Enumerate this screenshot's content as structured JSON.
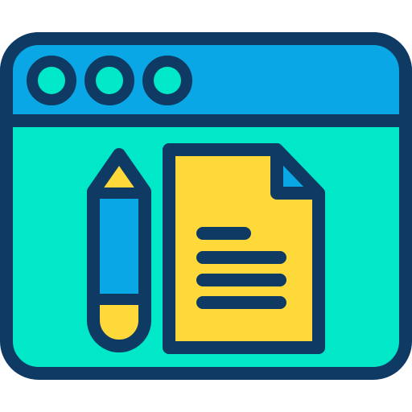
{
  "icon": {
    "name": "browser-document-edit-icon",
    "elements": {
      "window": "browser-window-icon",
      "title_bar": "browser-title-bar",
      "window_controls": [
        "window-control-dot",
        "window-control-dot",
        "window-control-dot"
      ],
      "pencil": "pencil-icon",
      "document": "document-icon",
      "document_lines": 4
    },
    "colors": {
      "outline": "#0f3a63",
      "title_bar": "#0aa7e6",
      "window_body": "#00e8c8",
      "control_dots": "#00e8c8",
      "pencil_body": "#0aa7e6",
      "pencil_tip": "#ffd93a",
      "pencil_end": "#ffd93a",
      "document_fill": "#ffd93a",
      "document_fold": "#0aa7e6",
      "document_lines": "#0f3a63"
    }
  }
}
